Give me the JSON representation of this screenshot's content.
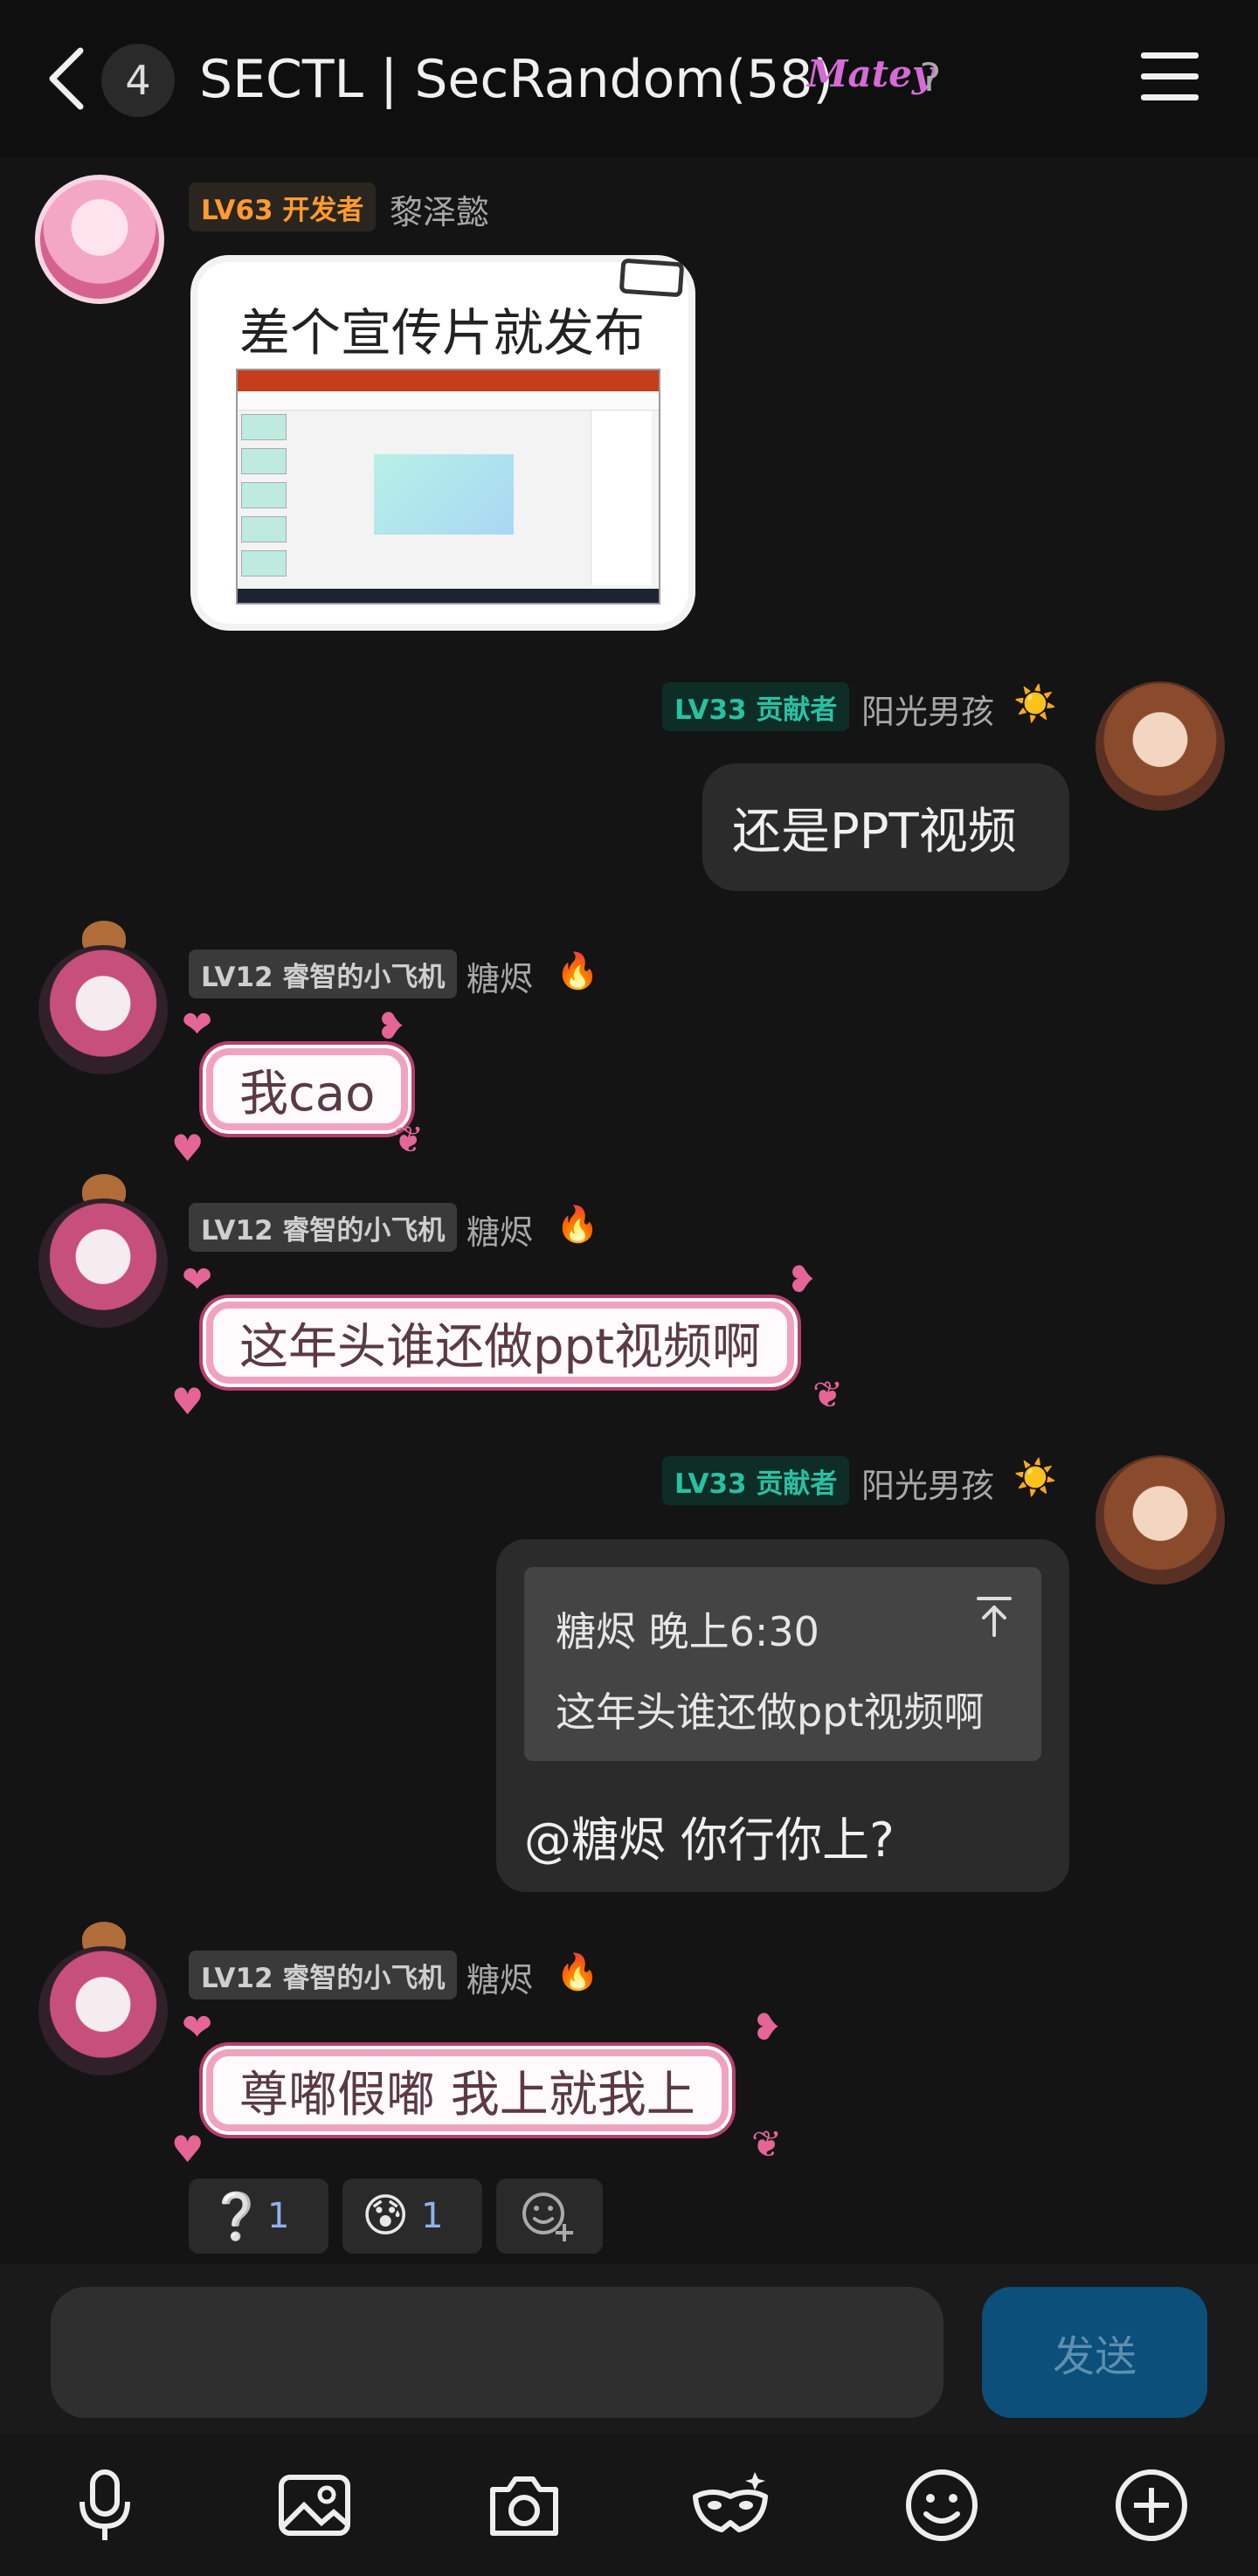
{
  "header": {
    "unread_count": "4",
    "title": "SECTL | SecRandom(58)",
    "brand_tag": "Matey"
  },
  "messages": [
    {
      "level": "LV63 开发者",
      "name": "黎泽懿",
      "card_text": "差个宣传片就发布"
    },
    {
      "level": "LV33 贡献者",
      "name": "阳光男孩",
      "name_icon": "☀️",
      "text": "还是PPT视频"
    },
    {
      "level": "LV12 睿智的小飞机",
      "name": "糖烬",
      "name_icon": "🔥",
      "text": "我cao"
    },
    {
      "level": "LV12 睿智的小飞机",
      "name": "糖烬",
      "name_icon": "🔥",
      "text": "这年头谁还做ppt视频啊"
    },
    {
      "level": "LV33 贡献者",
      "name": "阳光男孩",
      "name_icon": "☀️",
      "quote_header": "糖烬  晚上6:30",
      "quote_text": "这年头谁还做ppt视频啊",
      "text": "@糖烬  你行你上?"
    },
    {
      "level": "LV12 睿智的小飞机",
      "name": "糖烬",
      "name_icon": "🔥",
      "text": "尊嘟假嘟 我上就我上",
      "reactions": [
        {
          "emoji": "❔",
          "count": "1"
        },
        {
          "emoji": "😰",
          "count": "1"
        }
      ]
    }
  ],
  "composer": {
    "input_value": "",
    "send_label": "发送"
  },
  "toolbar_icons": [
    "microphone-icon",
    "image-icon",
    "camera-icon",
    "mask-icon",
    "smiley-icon",
    "plus-circle-icon"
  ],
  "colors": {
    "background": "#141414",
    "developer_badge": "#ff9b2f",
    "contributor_badge": "#29c1a0",
    "send_button": "#0b4f7a"
  }
}
